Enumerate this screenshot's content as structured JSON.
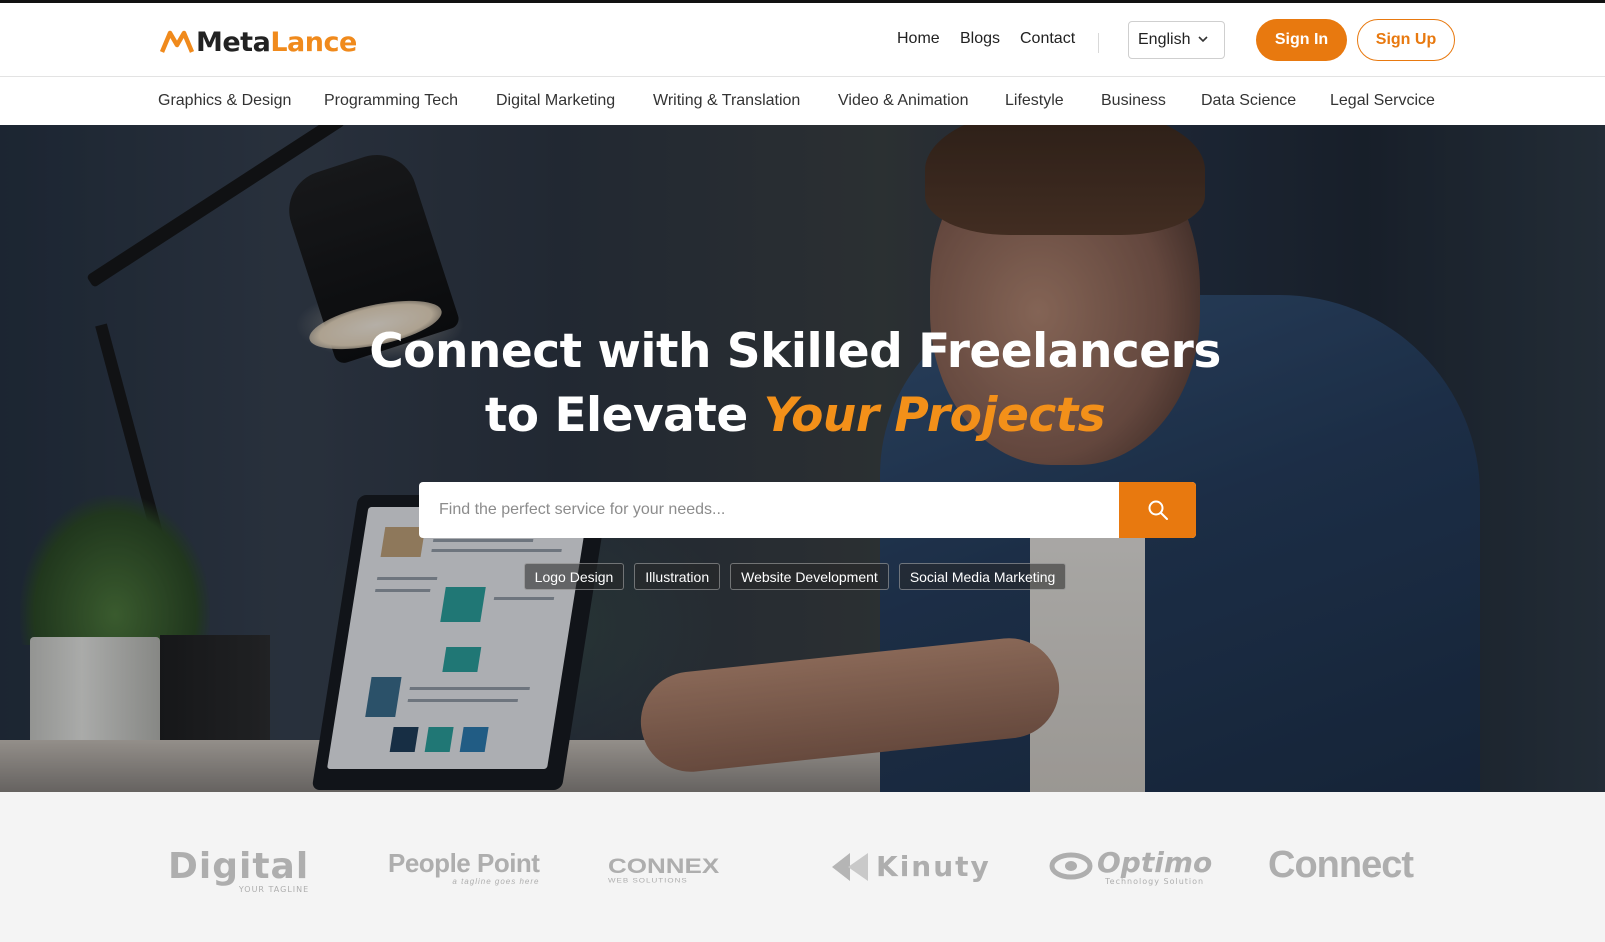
{
  "brand": {
    "part1": "Meta",
    "part2": "Lance",
    "accent": "#e8790f"
  },
  "topnav": {
    "home": "Home",
    "blogs": "Blogs",
    "contact": "Contact"
  },
  "language": {
    "selected": "English"
  },
  "auth": {
    "sign_in": "Sign In",
    "sign_up": "Sign Up"
  },
  "categories": [
    "Graphics & Design",
    "Programming Tech",
    "Digital Marketing",
    "Writing & Translation",
    "Video & Animation",
    "Lifestyle",
    "Business",
    "Data Science",
    "Legal Servcice"
  ],
  "hero": {
    "title_line1": "Connect with Skilled Freelancers",
    "title_line2_prefix": "to Elevate",
    "title_line2_highlight": "Your Projects",
    "search_placeholder": "Find the perfect service for your needs...",
    "tags": [
      "Logo Design",
      "Illustration",
      "Website Development",
      "Social Media Marketing"
    ]
  },
  "partners": [
    {
      "name": "Digital",
      "tagline": "YOUR TAGLINE"
    },
    {
      "name": "People Point",
      "tagline": "a tagline goes here"
    },
    {
      "name": "CONNEX",
      "tagline": "WEB SOLUTIONS"
    },
    {
      "name": "Kinuty",
      "tagline": ""
    },
    {
      "name": "Optimo",
      "tagline": "Technology Solution"
    },
    {
      "name": "Connect",
      "tagline": ""
    }
  ]
}
